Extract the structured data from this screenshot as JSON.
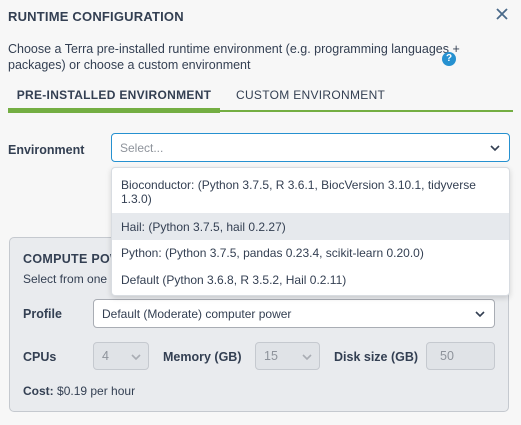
{
  "dialog": {
    "title": "RUNTIME CONFIGURATION",
    "description": "Choose a Terra pre-installed runtime environment (e.g. programming languages + packages) or choose a custom environment",
    "help_glyph": "?"
  },
  "tabs": [
    {
      "label": "PRE-INSTALLED ENVIRONMENT",
      "selected": true
    },
    {
      "label": "CUSTOM ENVIRONMENT",
      "selected": false
    }
  ],
  "environment": {
    "label": "Environment",
    "placeholder": "Select...",
    "options": [
      {
        "label": "Bioconductor: (Python 3.7.5, R 3.6.1, BiocVersion 3.10.1, tidyverse 1.3.0)"
      },
      {
        "label": "Hail: (Python 3.7.5, hail 0.2.27)",
        "highlighted": true
      },
      {
        "label": "Python: (Python 3.7.5, pandas 0.23.4, scikit-learn 0.20.0)"
      },
      {
        "label": "Default (Python 3.6.8, R 3.5.2, Hail 0.2.11)"
      }
    ]
  },
  "compute": {
    "title": "COMPUTE POW",
    "description": "Select from one",
    "profile_label": "Profile",
    "profile_value": "Default (Moderate) computer power",
    "cpus_label": "CPUs",
    "cpus_value": "4",
    "memory_label": "Memory (GB)",
    "memory_value": "15",
    "disk_label": "Disk size (GB)",
    "disk_value": "50",
    "cost_label": "Cost:",
    "cost_value": "$0.19 per hour"
  },
  "colors": {
    "accent_green": "#74ae43",
    "accent_blue": "#2691d0",
    "text": "#333f52"
  },
  "icons": {
    "close": "close-icon",
    "chevron": "chevron-down-icon",
    "help": "help-icon"
  }
}
